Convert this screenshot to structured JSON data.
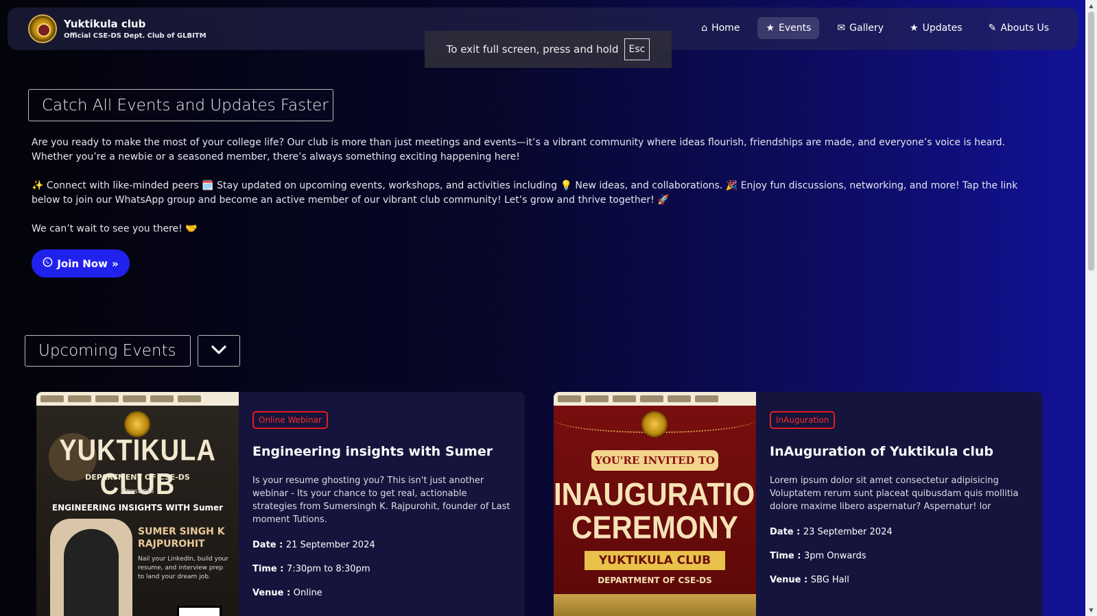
{
  "brand": {
    "title": "Yuktikula club",
    "subtitle": "Official CSE-DS Dept. Club of GLBITM"
  },
  "nav": {
    "items": [
      {
        "label": "Home",
        "icon": "home-icon",
        "active": false
      },
      {
        "label": "Events",
        "icon": "star-icon",
        "active": true
      },
      {
        "label": "Gallery",
        "icon": "envelope-icon",
        "active": false
      },
      {
        "label": "Updates",
        "icon": "star-icon",
        "active": false
      },
      {
        "label": "Abouts Us",
        "icon": "pencil-icon",
        "active": false
      }
    ]
  },
  "fullscreen_toast": {
    "text": "To exit full screen, press and hold",
    "key": "Esc"
  },
  "hero": {
    "title": "Catch All Events and Updates Faster",
    "paragraph1": "Are you ready to make the most of your college life? Our club is more than just meetings and events—it’s a vibrant community where ideas flourish, friendships are made, and everyone’s voice is heard. Whether you’re a newbie or a seasoned member, there’s always something exciting happening here!",
    "paragraph2": "✨ Connect with like-minded peers 🗓️ Stay updated on upcoming events, workshops, and activities including 💡 New ideas, and collaborations. 🎉 Enjoy fun discussions, networking, and more! Tap the link below to join our WhatsApp group and become an active member of our vibrant club community! Let’s grow and thrive together! 🚀",
    "paragraph3": "We can’t wait to see you there! 🤝",
    "join_label": "Join Now"
  },
  "events_section": {
    "title": "Upcoming Events"
  },
  "events": [
    {
      "badge": "Online Webinar",
      "title": "Engineering insights with Sumer",
      "description": "Is your resume ghosting you? This isn't just another webinar - Its your chance to get real, actionable strategies from Sumersingh K. Rajpurohit, founder of Last moment Tutions.",
      "date_label": "Date :",
      "date": "21 September 2024",
      "time_label": "Time :",
      "time": "7:30pm to 8:30pm",
      "venue_label": "Venue :",
      "venue": "Online",
      "poster": {
        "club": "YUKTIKULA CLUB",
        "dept": "DEPARTMENT OF CSE-DS",
        "presents": "Presents",
        "headline": "ENGINEERING INSIGHTS WITH Sumer",
        "speaker": "SUMER SINGH K RAJPUROHIT",
        "tagline": "Nail your LinkedIn, build your resume, and interview prep to land your dream job."
      }
    },
    {
      "badge": "InAuguration",
      "title": "InAuguration of Yuktikula club",
      "description": "Lorem ipsum dolor sit amet consectetur adipisicing Voluptatem rerum sunt placeat quibusdam quis mollitia dolore maxime libero aspernatur? Aspernatur! lor",
      "date_label": "Date :",
      "date": "23 September 2024",
      "time_label": "Time :",
      "time": "3pm Onwards",
      "venue_label": "Venue :",
      "venue": "SBG Hall",
      "poster": {
        "invited": "YOU'RE INVITED TO",
        "headline": "INAUGURATION CEREMONY",
        "club": "YUKTIKULA CLUB",
        "dept": "DEPARTMENT OF CSE-DS"
      }
    }
  ],
  "colors": {
    "accent_button": "#2121ee",
    "badge_red": "#e41f1f",
    "card_bg": "#14143c"
  }
}
